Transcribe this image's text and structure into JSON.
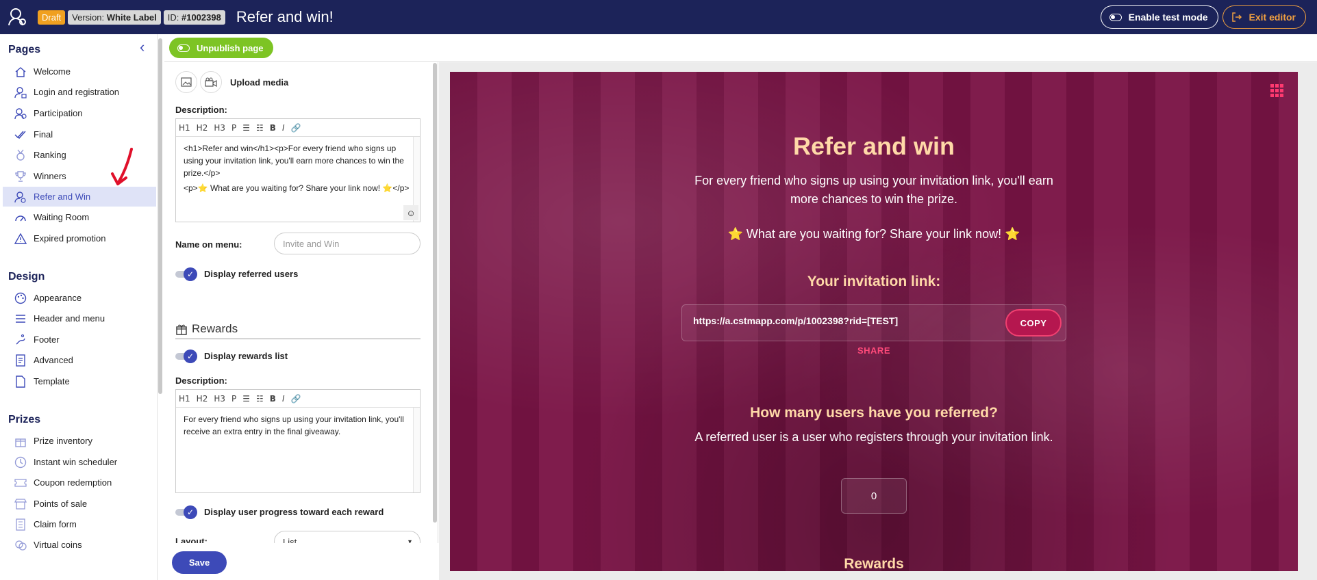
{
  "topbar": {
    "draft_badge": "Draft",
    "version_label": "Version:",
    "version_value": "White Label",
    "id_label": "ID:",
    "id_value": "#1002398",
    "title": "Refer and win!",
    "test_mode_label": "Enable test mode",
    "exit_label": "Exit editor"
  },
  "sidebar": {
    "pages_title": "Pages",
    "pages": [
      {
        "label": "Welcome",
        "icon": "home-icon"
      },
      {
        "label": "Login and registration",
        "icon": "user-lock-icon"
      },
      {
        "label": "Participation",
        "icon": "users-icon"
      },
      {
        "label": "Final",
        "icon": "double-check-icon"
      },
      {
        "label": "Ranking",
        "icon": "medal-icon"
      },
      {
        "label": "Winners",
        "icon": "trophy-icon"
      },
      {
        "label": "Refer and Win",
        "icon": "user-share-icon"
      },
      {
        "label": "Waiting Room",
        "icon": "gauge-icon"
      },
      {
        "label": "Expired promotion",
        "icon": "warning-icon"
      }
    ],
    "active_page": "Refer and Win",
    "design_title": "Design",
    "design": [
      {
        "label": "Appearance",
        "icon": "palette-icon"
      },
      {
        "label": "Header and menu",
        "icon": "menu-icon"
      },
      {
        "label": "Footer",
        "icon": "footprint-icon"
      },
      {
        "label": "Advanced",
        "icon": "code-file-icon"
      },
      {
        "label": "Template",
        "icon": "file-icon"
      }
    ],
    "prizes_title": "Prizes",
    "prizes": [
      {
        "label": "Prize inventory",
        "icon": "gift-icon"
      },
      {
        "label": "Instant win scheduler",
        "icon": "clock-icon"
      },
      {
        "label": "Coupon redemption",
        "icon": "coupon-icon"
      },
      {
        "label": "Points of sale",
        "icon": "store-icon"
      },
      {
        "label": "Claim form",
        "icon": "form-icon"
      },
      {
        "label": "Virtual coins",
        "icon": "coins-icon"
      }
    ]
  },
  "editor": {
    "unpublish_label": "Unpublish page",
    "upload_media_label": "Upload media",
    "description_label": "Description:",
    "toolbar": [
      "H1",
      "H2",
      "H3",
      "P"
    ],
    "description_html_1": "<h1>Refer and win</h1><p>For every friend who signs up using your invitation link, you'll earn more chances to win the prize.</p>",
    "description_html_2": "<p>⭐ What are you waiting for? Share your link now! ⭐</p>",
    "name_on_menu_label": "Name on menu:",
    "name_on_menu_placeholder": "Invite and Win",
    "display_referred_label": "Display referred users",
    "rewards_title": "Rewards",
    "display_rewards_label": "Display rewards list",
    "rewards_description_label": "Description:",
    "rewards_description": "For every friend who signs up using your invitation link, you'll receive an extra entry in the final giveaway.",
    "display_progress_label": "Display user progress toward each reward",
    "layout_label": "Layout:",
    "layout_value": "List",
    "save_label": "Save"
  },
  "preview": {
    "title": "Refer and win",
    "intro": "For every friend who signs up using your invitation link, you'll earn more chances to win the prize.",
    "cta": "⭐ What are you waiting for? Share your link now! ⭐",
    "invitation_title": "Your invitation link:",
    "invitation_link": "https://a.cstmapp.com/p/1002398?rid=[TEST]",
    "copy_label": "COPY",
    "share_label": "SHARE",
    "referred_title": "How many users have you referred?",
    "referred_text": "A referred user is a user who registers through your invitation link.",
    "referred_count": "0",
    "rewards_title": "Rewards"
  },
  "colors": {
    "topbar": "#1c2359",
    "accent": "#3d4ab8",
    "unpublish": "#7dc424",
    "preview_bg": "#7a1345",
    "preview_heading": "#ffd9a8",
    "copy": "#b5174f"
  }
}
